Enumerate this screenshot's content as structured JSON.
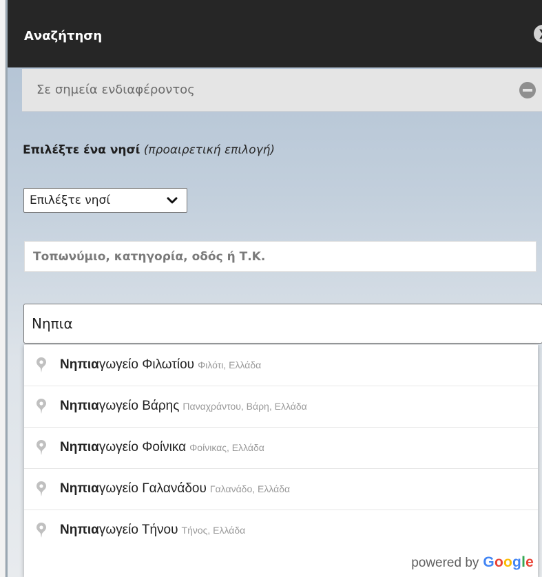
{
  "header": {
    "title": "Αναζήτηση",
    "arrow_glyph": "❯"
  },
  "section": {
    "title": "Σε σημεία ενδιαφέροντος",
    "collapse_icon": "minus-circle-icon"
  },
  "island": {
    "label_bold": "Επιλέξτε ένα νησί",
    "label_note": "(προαιρετική επιλογή)",
    "select_value": "Επιλέξτε νησί"
  },
  "place_field": {
    "placeholder": "Τοπωνύμιο, κατηγορία, οδός ή Τ.Κ."
  },
  "search": {
    "value": "Νηπια"
  },
  "suggestions": [
    {
      "match": "Νηπια",
      "rest": "γωγείο Φιλωτίου",
      "secondary": "Φιλότι, Ελλάδα"
    },
    {
      "match": "Νηπια",
      "rest": "γωγείο Βάρης",
      "secondary": "Παναχράντου, Βάρη, Ελλάδα"
    },
    {
      "match": "Νηπια",
      "rest": "γωγείο Φοίνικα",
      "secondary": "Φοίνικας, Ελλάδα"
    },
    {
      "match": "Νηπια",
      "rest": "γωγείο Γαλανάδου",
      "secondary": "Γαλανάδο, Ελλάδα"
    },
    {
      "match": "Νηπια",
      "rest": "γωγείο Τήνου",
      "secondary": "Τήνος, Ελλάδα"
    }
  ],
  "attribution": {
    "powered_by": "powered by",
    "google": [
      "G",
      "o",
      "o",
      "g",
      "l",
      "e"
    ]
  },
  "colors": {
    "header_bg": "#262626",
    "google_blue": "#4285f4",
    "google_red": "#ea4335",
    "google_yellow": "#fbbc05",
    "google_green": "#34a853"
  }
}
